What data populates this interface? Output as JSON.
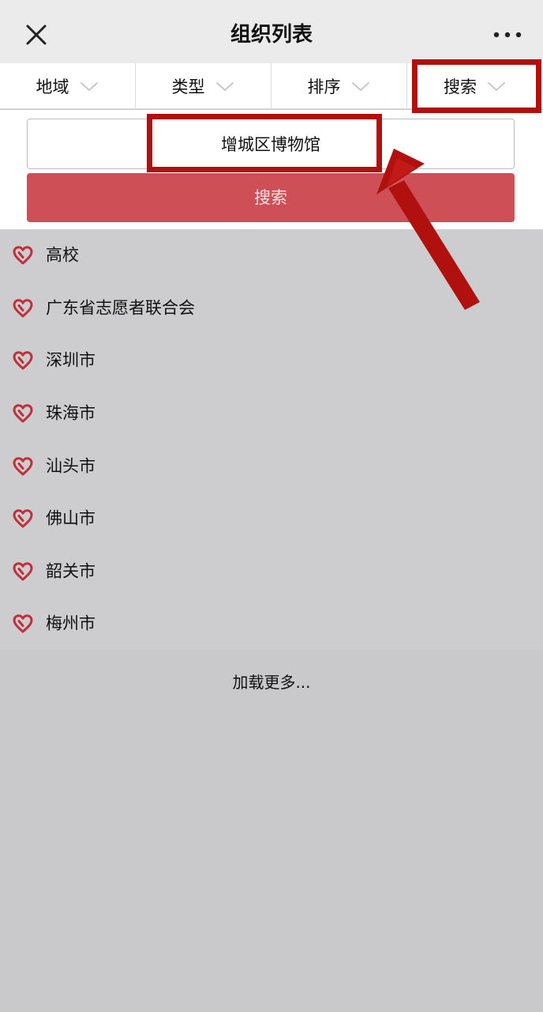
{
  "header": {
    "title": "组织列表",
    "close_icon": "close-icon",
    "more_icon": "more-horizontal-icon"
  },
  "filters": [
    {
      "label": "地域",
      "icon": "chevron-down-icon"
    },
    {
      "label": "类型",
      "icon": "chevron-down-icon"
    },
    {
      "label": "排序",
      "icon": "chevron-down-icon"
    },
    {
      "label": "搜索",
      "icon": "chevron-down-icon"
    }
  ],
  "search": {
    "value": "增城区博物馆",
    "button_label": "搜索"
  },
  "organizations": [
    {
      "name": "高校",
      "icon": "heart-icon"
    },
    {
      "name": "广东省志愿者联合会",
      "icon": "heart-icon"
    },
    {
      "name": "深圳市",
      "icon": "heart-icon"
    },
    {
      "name": "珠海市",
      "icon": "heart-icon"
    },
    {
      "name": "汕头市",
      "icon": "heart-icon"
    },
    {
      "name": "佛山市",
      "icon": "heart-icon"
    },
    {
      "name": "韶关市",
      "icon": "heart-icon"
    },
    {
      "name": "梅州市",
      "icon": "heart-icon"
    }
  ],
  "load_more": "加载更多...",
  "colors": {
    "accent": "#cf4f57",
    "heart": "#c0303a",
    "annotation": "#b0100e",
    "header_bg": "#ebebeb",
    "list_bg": "#cdcdcf"
  }
}
